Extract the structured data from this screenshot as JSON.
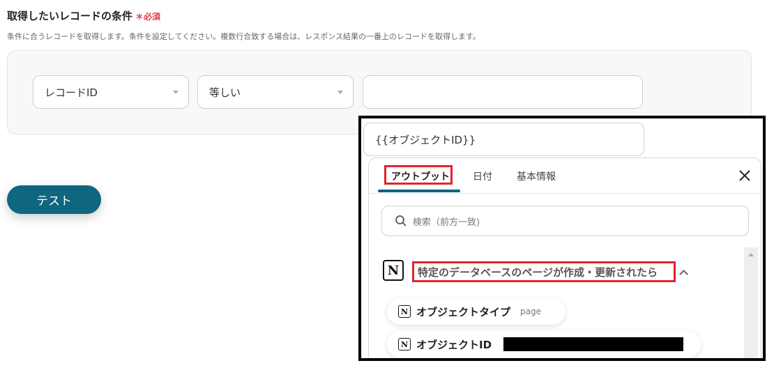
{
  "section": {
    "title": "取得したいレコードの条件",
    "required_mark": "＊",
    "required_label": "必須",
    "description": "条件に合うレコードを取得します。条件を設定してください。複数行合致する場合は、レスポンス結果の一番上のレコードを取得します。"
  },
  "condition": {
    "field": "レコードID",
    "operator": "等しい",
    "value": "",
    "value_second": "{{オブジェクトID}}"
  },
  "test_button": "テスト",
  "dropdown": {
    "tabs": [
      "アウトプット",
      "日付",
      "基本情報"
    ],
    "active_tab": "アウトプット",
    "search_placeholder": "検索（前方一致)",
    "group_icon_letter": "N",
    "group_label": "特定のデータベースのページが作成・更新されたら",
    "items": [
      {
        "label": "オブジェクトタイプ",
        "value": "page"
      },
      {
        "label": "オブジェクトID",
        "value": ""
      }
    ]
  },
  "colors": {
    "accent": "#0f6680",
    "required": "#e23b4e",
    "highlight": "#e0242c"
  }
}
